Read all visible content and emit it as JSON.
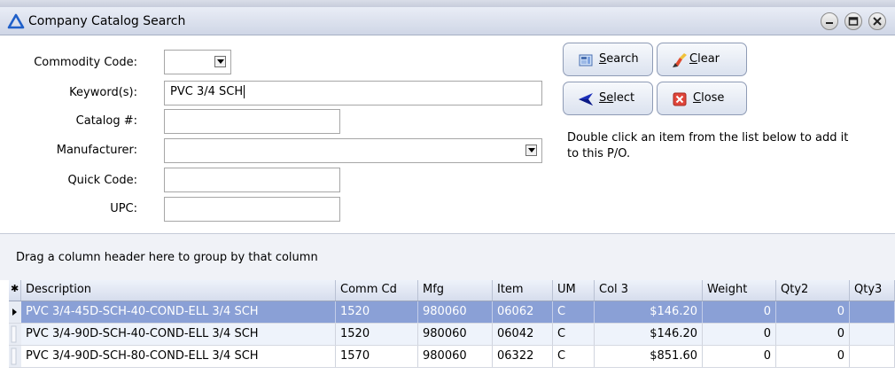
{
  "window": {
    "title": "Company Catalog Search"
  },
  "form": {
    "commodity_label": "Commodity Code:",
    "commodity_value": "",
    "keyword_label": "Keyword(s):",
    "keyword_value": "PVC 3/4 SCH",
    "catalog_label": "Catalog #:",
    "catalog_value": "",
    "manufacturer_label": "Manufacturer:",
    "manufacturer_value": "",
    "quickcode_label": "Quick Code:",
    "quickcode_value": "",
    "upc_label": "UPC:",
    "upc_value": ""
  },
  "buttons": {
    "search_first": "S",
    "search_rest": "earch",
    "clear_first": "C",
    "clear_rest": "lear",
    "select_first": "S",
    "select_mid": "e",
    "select_rest": "lect",
    "close_first": "C",
    "close_rest": "lose"
  },
  "hint": "Double click an item from the list below to add it to this P/O.",
  "grid": {
    "group_hint": "Drag a column header here to group by that column",
    "columns": [
      "Description",
      "Comm Cd",
      "Mfg",
      "Item",
      "UM",
      "Col 3",
      "Weight",
      "Qty2",
      "Qty3"
    ],
    "rows": [
      [
        "PVC 3/4-45D-SCH-40-COND-ELL 3/4 SCH",
        "1520",
        "980060",
        "06062",
        "C",
        "$146.20",
        "0",
        "0",
        ""
      ],
      [
        "PVC 3/4-90D-SCH-40-COND-ELL 3/4 SCH",
        "1520",
        "980060",
        "06042",
        "C",
        "$146.20",
        "0",
        "0",
        ""
      ],
      [
        "PVC 3/4-90D-SCH-80-COND-ELL 3/4 SCH",
        "1570",
        "980060",
        "06322",
        "C",
        "$851.60",
        "0",
        "0",
        ""
      ]
    ],
    "selected_row": 0
  }
}
